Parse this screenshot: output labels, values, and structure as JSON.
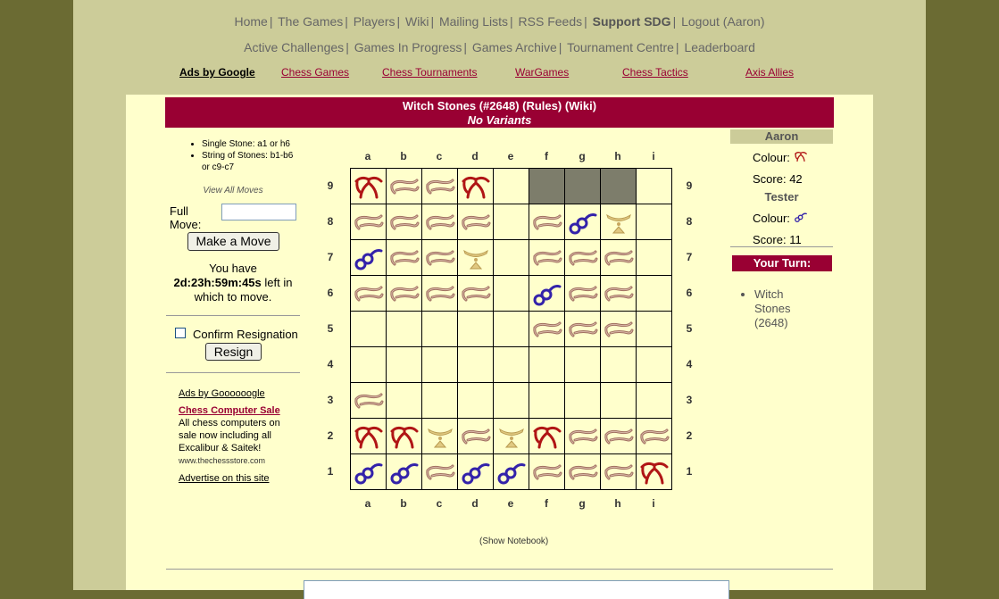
{
  "nav1": [
    "Home",
    "The Games",
    "Players",
    "Wiki",
    "Mailing Lists",
    "RSS Feeds",
    "Support SDG",
    "Logout (Aaron)"
  ],
  "nav2": [
    "Active Challenges",
    "Games In Progress",
    "Games Archive",
    "Tournament Centre",
    "Leaderboard"
  ],
  "ads": {
    "label": "Ads by Google",
    "links": [
      "Chess Games",
      "Chess Tournaments",
      "WarGames",
      "Chess Tactics",
      "Axis Allies"
    ]
  },
  "title": {
    "main": "Witch Stones (#2648) (Rules) (Wiki)",
    "sub": "No Variants"
  },
  "help": [
    "Single Stone: a1 or h6",
    "String of Stones: b1-b6 or c9-c7"
  ],
  "view_all": "View All Moves",
  "full_move_label": "Full Move:",
  "make_move": "Make a Move",
  "timer": {
    "pre": "You have",
    "time": "2d:23h:59m:45s",
    "post1": "left in",
    "post2": "which to move."
  },
  "confirm_resign": "Confirm Resignation",
  "resign": "Resign",
  "adbox": {
    "head": "Ads by Goooooogle",
    "title": "Chess Computer Sale",
    "text": "All chess computers on sale now including all Excalibur & Saitek!",
    "url": "www.thechessstore.com",
    "advertise": "Advertise on this site"
  },
  "files": [
    "a",
    "b",
    "c",
    "d",
    "e",
    "f",
    "g",
    "h",
    "i"
  ],
  "ranks": [
    "9",
    "8",
    "7",
    "6",
    "5",
    "4",
    "3",
    "2",
    "1"
  ],
  "board": [
    [
      "X",
      "S",
      "S",
      "X",
      "",
      "",
      "",
      "",
      ""
    ],
    [
      "S",
      "S",
      "S",
      "S",
      "",
      "S",
      "B",
      "W",
      ""
    ],
    [
      "B",
      "S",
      "S",
      "W",
      "",
      "S",
      "S",
      "S",
      ""
    ],
    [
      "S",
      "S",
      "S",
      "S",
      "",
      "B",
      "S",
      "S",
      ""
    ],
    [
      "",
      "",
      "",
      "",
      "",
      "S",
      "S",
      "S",
      ""
    ],
    [
      "",
      "",
      "",
      "",
      "",
      "",
      "",
      "",
      ""
    ],
    [
      "S",
      "",
      "",
      "",
      "",
      "",
      "",
      "",
      ""
    ],
    [
      "X",
      "X",
      "W",
      "S",
      "W",
      "X",
      "S",
      "S",
      "S"
    ],
    [
      "B",
      "B",
      "S",
      "B",
      "B",
      "S",
      "S",
      "S",
      "X"
    ]
  ],
  "highlighted": [
    "f9",
    "g9",
    "h9"
  ],
  "players": [
    {
      "name": "Aaron",
      "colour_label": "Colour:",
      "colour_icon": "red-witch-icon",
      "score_label": "Score:",
      "score": "42"
    },
    {
      "name": "Tester",
      "colour_label": "Colour:",
      "colour_icon": "blue-witch-icon",
      "score_label": "Score:",
      "score": "11"
    }
  ],
  "your_turn": "Your Turn:",
  "turn_games": [
    "Witch Stones (2648)"
  ],
  "notebook": "(Show Notebook)",
  "colors": {
    "accent": "#990033",
    "page_bg": "#cccc99",
    "outer_bg": "#6b6b33",
    "content_bg": "#ffffcc",
    "highlight": "#7d7d6b"
  }
}
